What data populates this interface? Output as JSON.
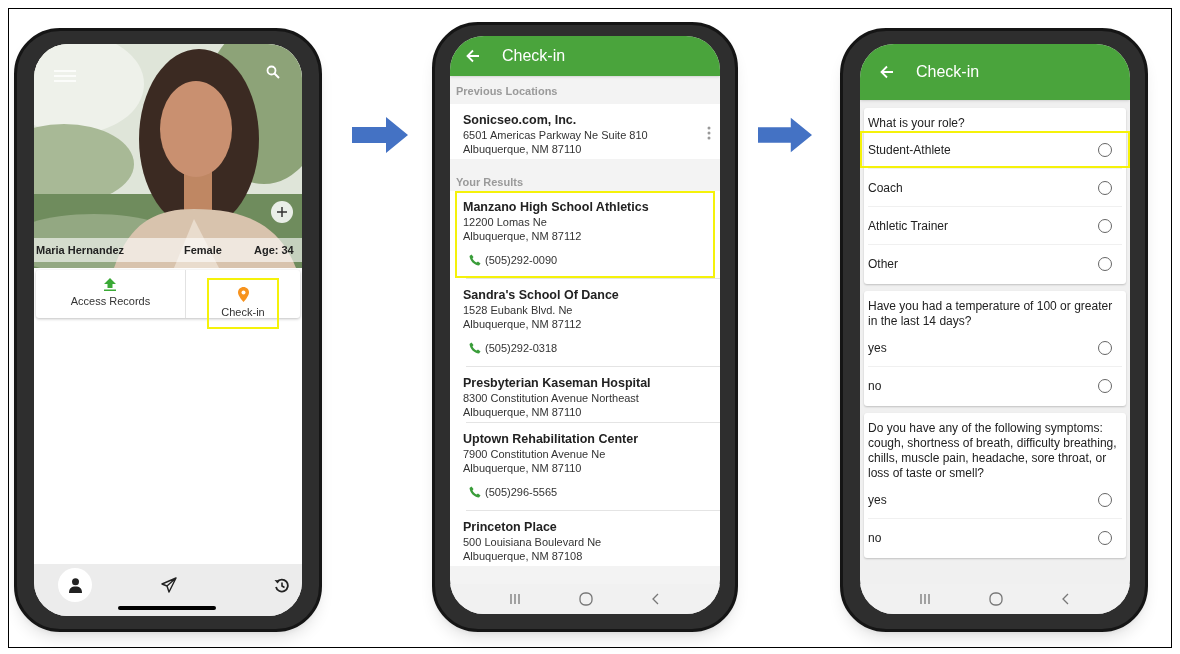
{
  "profile_screen": {
    "name": "Maria Hernandez",
    "gender": "Female",
    "age": "Age: 34",
    "actions": [
      {
        "kind": "records",
        "label": "Access Records",
        "highlighted": false
      },
      {
        "kind": "checkin",
        "label": "Check-in",
        "highlighted": true
      }
    ],
    "bottom_nav": [
      {
        "kind": "profile",
        "selected": true
      },
      {
        "kind": "send",
        "selected": false
      },
      {
        "kind": "history",
        "selected": false
      }
    ]
  },
  "locations_screen": {
    "title": "Check-in",
    "sections": [
      {
        "heading": "Previous Locations",
        "items": [
          {
            "name": "Sonicseo.com, Inc.",
            "address": [
              "6501 Americas Parkway Ne Suite 810",
              "Albuquerque, NM 87110"
            ],
            "more_menu": true,
            "highlighted": false
          }
        ]
      },
      {
        "heading": "Your Results",
        "items": [
          {
            "name": "Manzano High School Athletics",
            "address": [
              "12200 Lomas Ne",
              "Albuquerque, NM 87112"
            ],
            "phone": "(505)292-0090",
            "more_menu": false,
            "highlighted": true
          },
          {
            "name": "Sandra's School Of Dance",
            "address": [
              "1528 Eubank Blvd. Ne",
              "Albuquerque, NM 87112"
            ],
            "phone": "(505)292-0318",
            "more_menu": false,
            "highlighted": false
          },
          {
            "name": "Presbyterian Kaseman Hospital",
            "address": [
              "8300 Constitution Avenue Northeast",
              "Albuquerque, NM 87110"
            ],
            "more_menu": false,
            "highlighted": false
          },
          {
            "name": "Uptown Rehabilitation Center",
            "address": [
              "7900 Constitution Avenue Ne",
              "Albuquerque, NM 87110"
            ],
            "phone": "(505)296-5565",
            "more_menu": false,
            "highlighted": false
          },
          {
            "name": "Princeton Place",
            "address": [
              "500 Louisiana Boulevard Ne",
              "Albuquerque, NM 87108"
            ],
            "more_menu": false,
            "highlighted": false
          }
        ]
      }
    ]
  },
  "questionnaire_screen": {
    "title": "Check-in",
    "questions": [
      {
        "text": "What is your role?",
        "options": [
          {
            "label": "Student-Athlete",
            "selected": false,
            "highlighted": true
          },
          {
            "label": "Coach",
            "selected": false,
            "highlighted": false
          },
          {
            "label": "Athletic Trainer",
            "selected": false,
            "highlighted": false
          },
          {
            "label": "Other",
            "selected": false,
            "highlighted": false
          }
        ]
      },
      {
        "text": "Have you had a temperature of 100 or greater in the last 14 days?",
        "options": [
          {
            "label": "yes",
            "selected": false,
            "highlighted": false
          },
          {
            "label": "no",
            "selected": false,
            "highlighted": false
          }
        ]
      },
      {
        "text": "Do you have any of the following symptoms: cough, shortness of breath, difficulty breathing, chills, muscle pain, headache, sore throat, or loss of taste or smell?",
        "options": [
          {
            "label": "yes",
            "selected": false,
            "highlighted": false
          },
          {
            "label": "no",
            "selected": false,
            "highlighted": false
          }
        ]
      }
    ]
  }
}
